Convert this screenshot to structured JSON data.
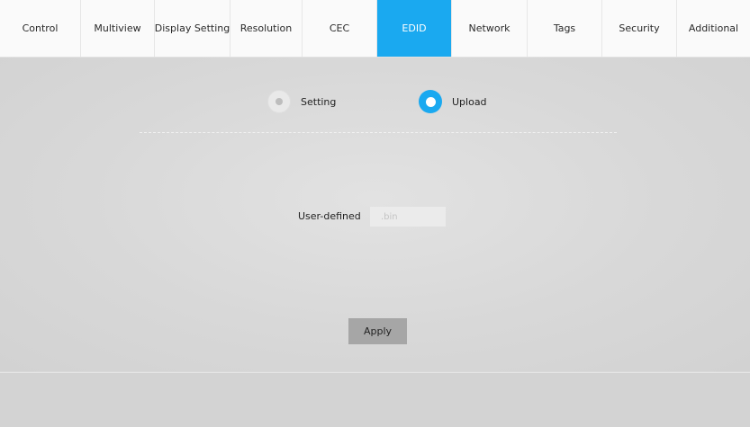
{
  "tabs": [
    {
      "label": "Control",
      "active": false
    },
    {
      "label": "Multiview",
      "active": false
    },
    {
      "label": "Display Setting",
      "active": false
    },
    {
      "label": "Resolution",
      "active": false
    },
    {
      "label": "CEC",
      "active": false
    },
    {
      "label": "EDID",
      "active": true
    },
    {
      "label": "Network",
      "active": false
    },
    {
      "label": "Tags",
      "active": false
    },
    {
      "label": "Security",
      "active": false
    },
    {
      "label": "Additional",
      "active": false
    }
  ],
  "mode": {
    "setting_label": "Setting",
    "upload_label": "Upload",
    "selected": "Upload"
  },
  "user_defined": {
    "label": "User-defined",
    "placeholder": ".bin",
    "value": ""
  },
  "apply_label": "Apply",
  "colors": {
    "accent": "#1aa9f0",
    "background": "#d9d9d9",
    "button": "#a6a6a6"
  }
}
